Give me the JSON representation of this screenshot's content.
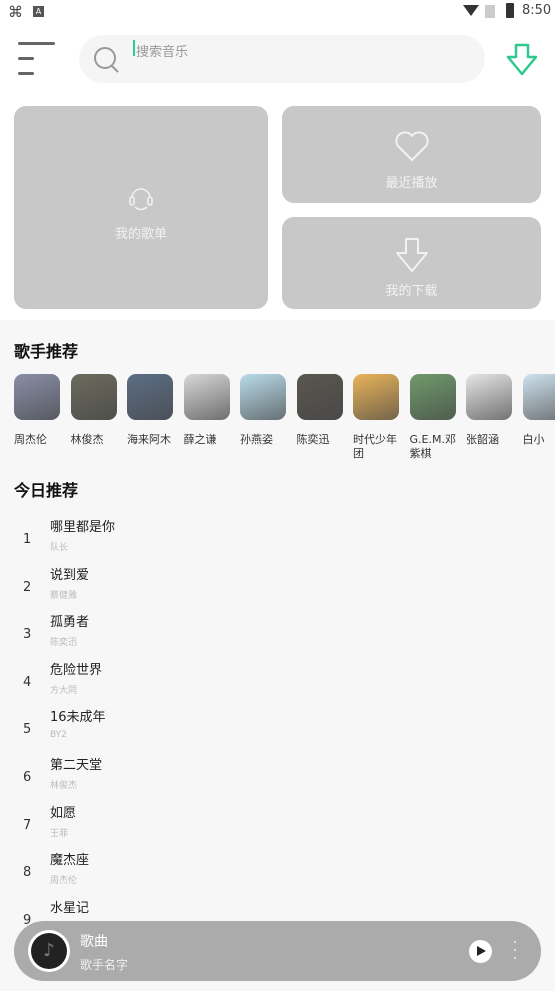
{
  "status_bar": {
    "time": "8:50"
  },
  "search": {
    "placeholder": "搜索音乐"
  },
  "colors": {
    "accent": "#2dc98f",
    "card": "#c8c8c8",
    "player": "#ababab"
  },
  "cards": {
    "playlist": "我的歌单",
    "recent": "最近播放",
    "download": "我的下载"
  },
  "artists_section": {
    "title": "歌手推荐",
    "items": [
      {
        "name": "周杰伦",
        "color": "#8a8fa8"
      },
      {
        "name": "林俊杰",
        "color": "#6b6b5e"
      },
      {
        "name": "海来阿木",
        "color": "#5c6e86"
      },
      {
        "name": "薛之谦",
        "color": "#d8d8d8"
      },
      {
        "name": "孙燕姿",
        "color": "#b9dcea"
      },
      {
        "name": "陈奕迅",
        "color": "#5a5650"
      },
      {
        "name": "时代少年团",
        "color": "#e9b45a"
      },
      {
        "name": "G.E.M.邓紫棋",
        "color": "#6f9a6a"
      },
      {
        "name": "张韶涵",
        "color": "#e6e6e6"
      },
      {
        "name": "白小",
        "color": "#cfe2ee"
      }
    ]
  },
  "today_section": {
    "title": "今日推荐",
    "songs": [
      {
        "no": "1",
        "title": "哪里都是你",
        "artist": "队长"
      },
      {
        "no": "2",
        "title": "说到爱",
        "artist": "蔡健雅"
      },
      {
        "no": "3",
        "title": "孤勇者",
        "artist": "陈奕迅"
      },
      {
        "no": "4",
        "title": "危险世界",
        "artist": "方大同"
      },
      {
        "no": "5",
        "title": "16未成年",
        "artist": "BY2"
      },
      {
        "no": "6",
        "title": "第二天堂",
        "artist": "林俊杰"
      },
      {
        "no": "7",
        "title": "如愿",
        "artist": "王菲"
      },
      {
        "no": "8",
        "title": "魔杰座",
        "artist": "周杰伦"
      },
      {
        "no": "9",
        "title": "水星记",
        "artist": ""
      }
    ]
  },
  "player": {
    "song": "歌曲",
    "artist": "歌手名字"
  }
}
